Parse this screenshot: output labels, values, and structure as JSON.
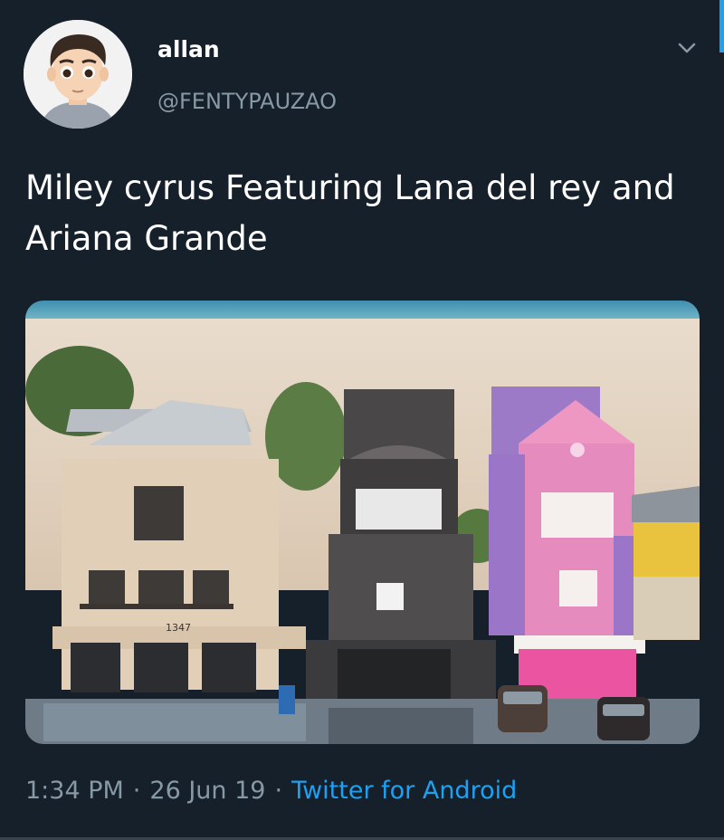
{
  "tweet": {
    "display_name": "allan",
    "handle": "@FENTYPAUZAO",
    "text": "Miley cyrus Featuring Lana del rey and Ariana Grande",
    "time": "1:34 PM",
    "date": "26 Jun 19",
    "separator": "·",
    "source": "Twitter for Android"
  },
  "media": {
    "house_number": "1347"
  },
  "colors": {
    "background": "#15202b",
    "accent": "#1da1f2",
    "secondary_text": "#8899a6"
  },
  "icons": {
    "menu_caret": "chevron-down-icon"
  }
}
